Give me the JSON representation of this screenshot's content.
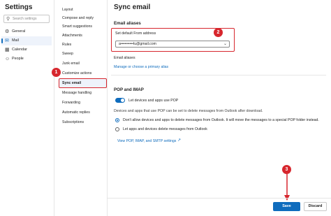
{
  "left_pane": {
    "title": "Settings",
    "search_placeholder": "Search settings",
    "categories": [
      {
        "label": "General",
        "icon": "gear-icon",
        "active": false
      },
      {
        "label": "Mail",
        "icon": "mail-icon",
        "active": true
      },
      {
        "label": "Calendar",
        "icon": "calendar-icon",
        "active": false
      },
      {
        "label": "People",
        "icon": "people-icon",
        "active": false
      }
    ]
  },
  "sub_menu": {
    "items": [
      "Layout",
      "Compose and reply",
      "Smart suggestions",
      "Attachments",
      "Rules",
      "Sweep",
      "Junk email",
      "Customize actions",
      "Sync email",
      "Message handling",
      "Forwarding",
      "Automatic replies",
      "Subscriptions"
    ],
    "selected": "Sync email"
  },
  "content": {
    "title": "Sync email",
    "email_aliases_heading": "Email aliases",
    "default_from_label": "Set default From address",
    "default_from_value": "a••••••••••lu@gmail.com",
    "email_aliases_subheading": "Email aliases",
    "manage_link": "Manage or choose a primary alias",
    "pop_heading": "POP and IMAP",
    "pop_toggle_label": "Let devices and apps use POP",
    "pop_description": "Devices and apps that use POP can be set to delete messages from Outlook after download.",
    "radio_option_1": "Don't allow devices and apps to delete messages from Outlook. It will move the messages to a special POP folder instead.",
    "radio_option_2": "Let apps and devices delete messages from Outlook",
    "settings_link": "View POP, IMAP, and SMTP settings"
  },
  "annotations": [
    "1",
    "2",
    "3"
  ],
  "footer": {
    "save_label": "Save",
    "discard_label": "Discard"
  },
  "colors": {
    "accent": "#0f6cbd",
    "annotation_red": "#d7262d"
  }
}
